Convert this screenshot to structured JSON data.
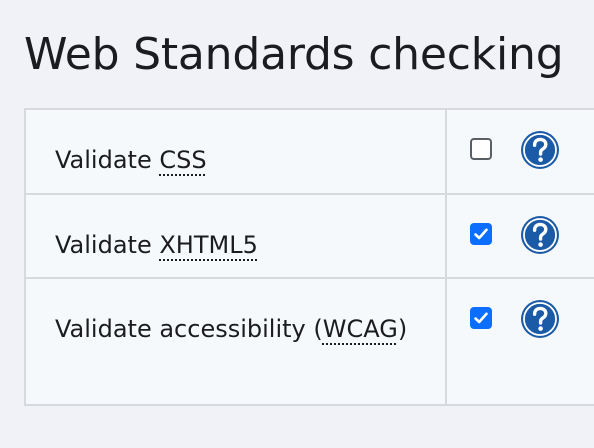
{
  "page": {
    "title": "Web Standards checking"
  },
  "rows": [
    {
      "prefix": "Validate ",
      "abbr": "CSS",
      "suffix": "",
      "checked": false
    },
    {
      "prefix": "Validate ",
      "abbr": "XHTML5",
      "suffix": "",
      "checked": true
    },
    {
      "prefix": "Validate accessibility (",
      "abbr": "WCAG",
      "suffix": ")",
      "checked": true
    }
  ],
  "help_icon": "question-circle",
  "colors": {
    "checkbox_checked": "#0b6efd",
    "help_icon": "#1a5aa6",
    "background": "#f0f2f7",
    "table_background": "#f5f9fc"
  }
}
